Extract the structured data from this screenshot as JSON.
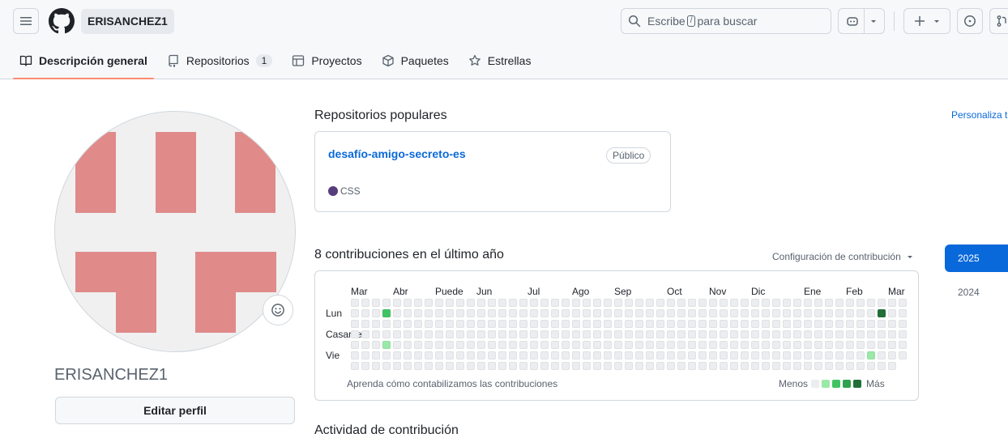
{
  "header": {
    "username": "ERISANCHEZ1",
    "search_prefix": "Escribe",
    "search_key": "/",
    "search_suffix": "para buscar"
  },
  "tabs": [
    {
      "label": "Descripción general",
      "icon": "book-icon",
      "active": true
    },
    {
      "label": "Repositorios",
      "icon": "repo-icon",
      "count": "1"
    },
    {
      "label": "Proyectos",
      "icon": "table-icon"
    },
    {
      "label": "Paquetes",
      "icon": "package-icon"
    },
    {
      "label": "Estrellas",
      "icon": "star-icon"
    }
  ],
  "sidebar": {
    "username": "ERISANCHEZ1",
    "edit_label": "Editar perfil"
  },
  "popular": {
    "title": "Repositorios populares",
    "customize": "Personaliza tu",
    "repo": {
      "name": "desafío-amigo-secreto-es",
      "visibility": "Público",
      "language": "CSS",
      "language_color": "#563d7c"
    }
  },
  "contributions": {
    "title": "8 contribuciones en el último año",
    "settings": "Configuración de contribución",
    "months": [
      "Mar",
      "Abr",
      "Puede",
      "Jun",
      "Jul",
      "Ago",
      "Sep",
      "Oct",
      "Nov",
      "Dic",
      "Ene",
      "Feb",
      "Mar"
    ],
    "days": [
      "Lun",
      "Casarse",
      "Vie"
    ],
    "learn": "Aprenda cómo contabilizamos las contribuciones",
    "less": "Menos",
    "more": "Más",
    "levels": [
      "#ebedf0",
      "#9be9a8",
      "#40c463",
      "#30a14e",
      "#216e39"
    ],
    "weeks": 53,
    "filled": [
      {
        "week": 3,
        "day": 1,
        "level": 2
      },
      {
        "week": 3,
        "day": 4,
        "level": 1
      },
      {
        "week": 50,
        "day": 1,
        "level": 4
      },
      {
        "week": 49,
        "day": 5,
        "level": 1
      }
    ]
  },
  "years": [
    "2025",
    "2024"
  ],
  "activity_title": "Actividad de contribución"
}
